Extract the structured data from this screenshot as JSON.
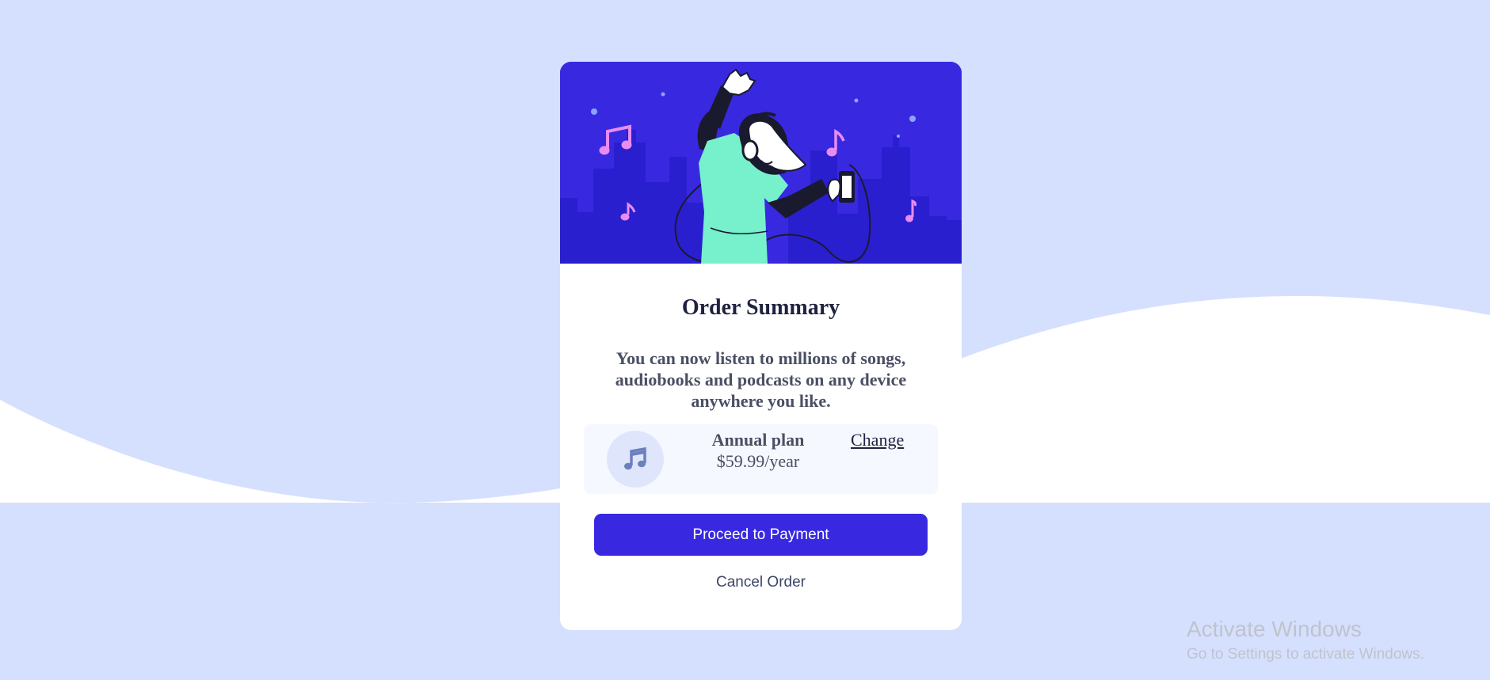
{
  "page": {
    "background_color": "#d5e0fe",
    "wave_color": "#ffffff"
  },
  "hero": {
    "background_color": "#3829e0",
    "illustration": "woman-dancing-with-headphones-illustration",
    "icons": [
      "music-note-icon",
      "headphones-icon",
      "phone-icon"
    ]
  },
  "card": {
    "title": "Order Summary",
    "description": "You can now listen to millions of songs, audiobooks and podcasts on any device anywhere you like.",
    "plan": {
      "icon": "music-note-icon",
      "name": "Annual plan",
      "price": "$59.99/year",
      "change_label": "Change"
    },
    "proceed_label": "Proceed to Payment",
    "cancel_label": "Cancel Order"
  },
  "colors": {
    "accent": "#3829e0",
    "title": "#1f2340",
    "body_text": "#4a4f63",
    "plan_box": "#f5f8ff"
  },
  "watermark": {
    "title": "Activate Windows",
    "subtitle": "Go to Settings to activate Windows."
  }
}
